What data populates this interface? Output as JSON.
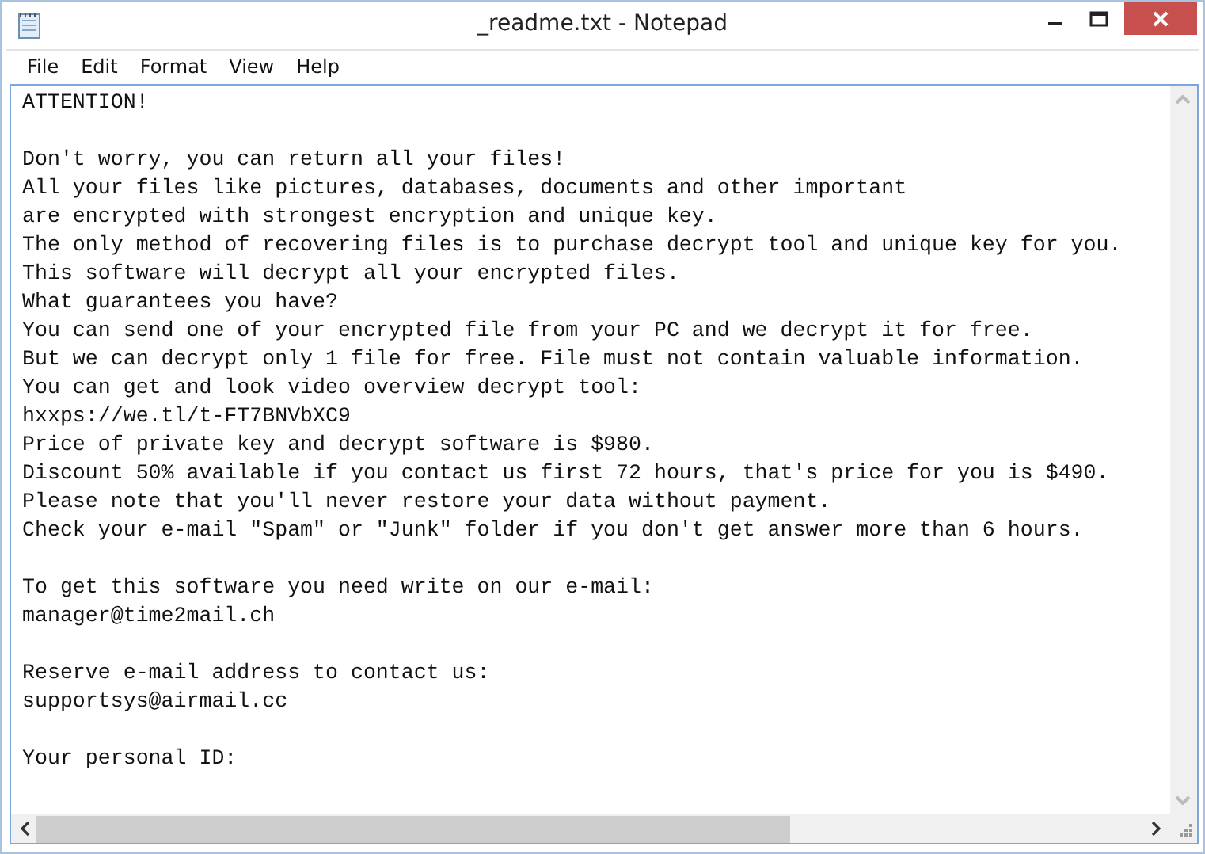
{
  "window": {
    "title": "_readme.txt - Notepad"
  },
  "menu": [
    {
      "label": "File"
    },
    {
      "label": "Edit"
    },
    {
      "label": "Format"
    },
    {
      "label": "View"
    },
    {
      "label": "Help"
    }
  ],
  "document": {
    "paragraphs": [
      [
        "ATTENTION!"
      ],
      [
        "Don't worry, you can return all your files!",
        "All your files like pictures, databases, documents and other important",
        "are encrypted with strongest encryption and unique key.",
        "The only method of recovering files is to purchase decrypt tool and unique key for you.",
        "This software will decrypt all your encrypted files.",
        "What guarantees you have?",
        "You can send one of your encrypted file from your PC and we decrypt it for free.",
        "But we can decrypt only 1 file for free. File must not contain valuable information.",
        "You can get and look video overview decrypt tool:",
        "hxxps://we.tl/t-FT7BNVbXC9",
        "Price of private key and decrypt software is $980.",
        "Discount 50% available if you contact us first 72 hours, that's price for you is $490.",
        "Please note that you'll never restore your data without payment.",
        "Check your e-mail \"Spam\" or \"Junk\" folder if you don't get answer more than 6 hours."
      ],
      [
        "To get this software you need write on our e-mail:",
        "manager@time2mail.ch"
      ],
      [
        "Reserve e-mail address to contact us:",
        "supportsys@airmail.cc"
      ],
      [
        "Your personal ID:"
      ]
    ]
  }
}
